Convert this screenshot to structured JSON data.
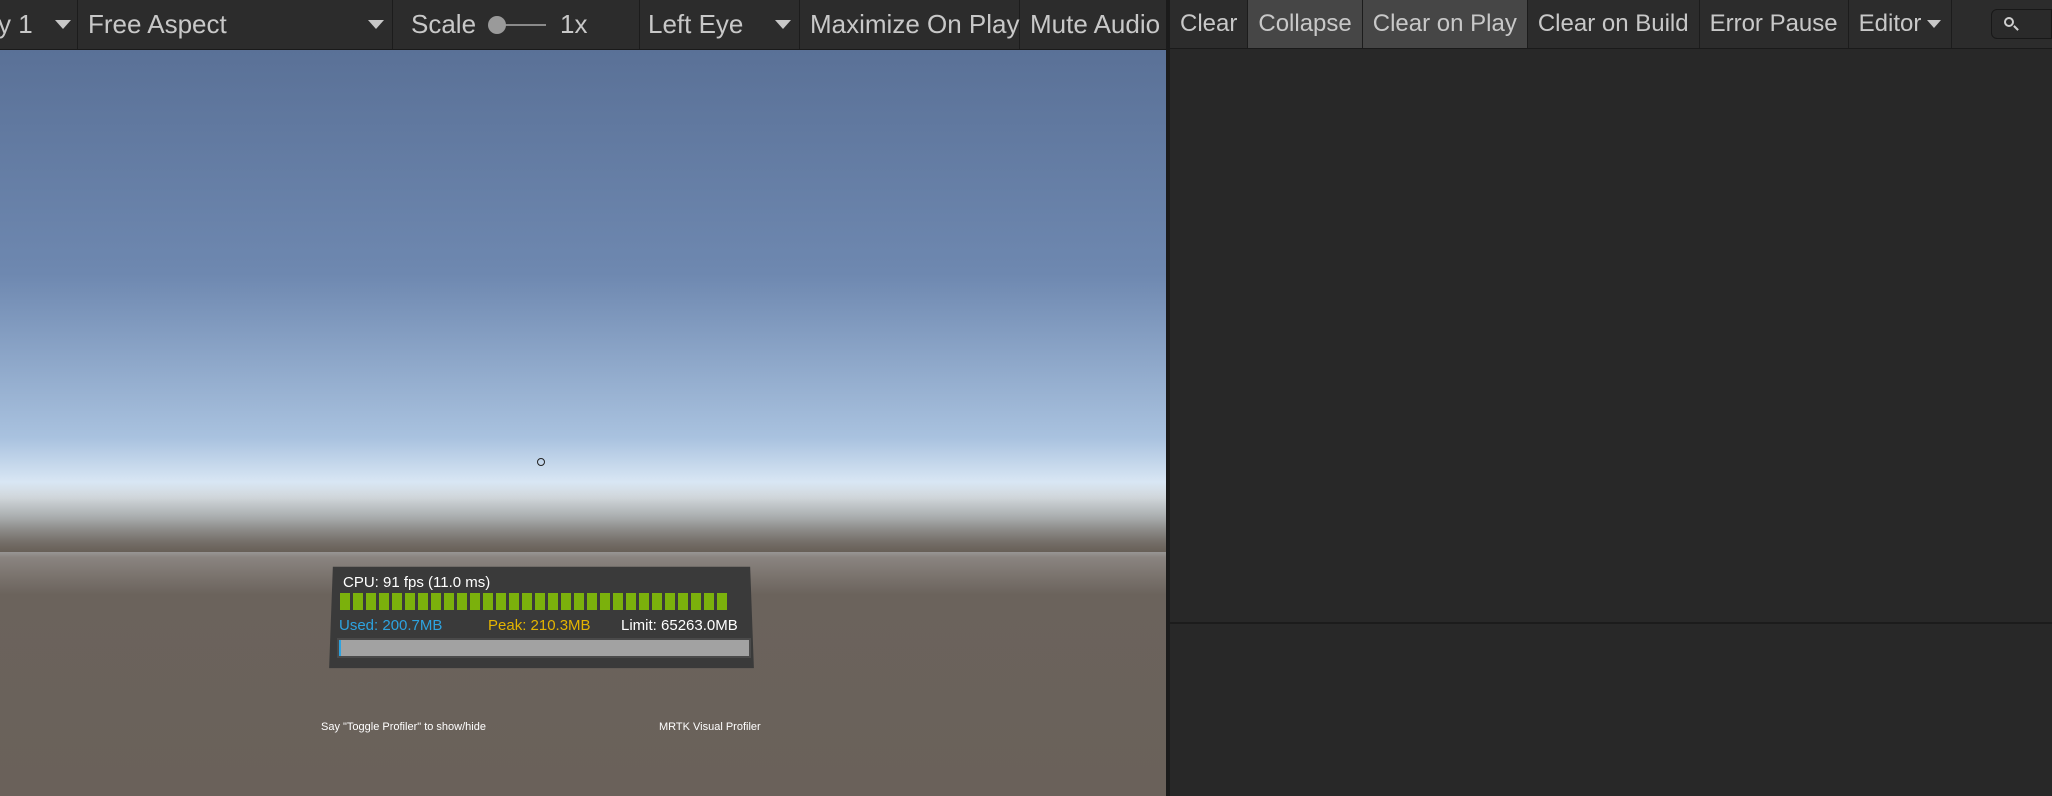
{
  "game_toolbar": {
    "display_label": "y 1",
    "aspect_label": "Free Aspect",
    "scale_label": "Scale",
    "scale_value": "1x",
    "eye_label": "Left Eye",
    "maximize_label": "Maximize On Play",
    "mute_label": "Mute Audio"
  },
  "profiler": {
    "cpu_text": "CPU: 91 fps (11.0 ms)",
    "used_text": "Used: 200.7MB",
    "peak_text": "Peak: 210.3MB",
    "limit_text": "Limit: 65263.0MB",
    "memory_used_fraction": 0.003,
    "hint_text": "Say \"Toggle Profiler\" to show/hide",
    "brand_text": "MRTK Visual Profiler",
    "colors": {
      "bar": "#7bb10c",
      "used": "#2da3e0",
      "peak": "#e4b400",
      "panel": "#3a3a3a"
    }
  },
  "console_toolbar": {
    "clear_label": "Clear",
    "collapse_label": "Collapse",
    "clear_on_play_label": "Clear on Play",
    "clear_on_build_label": "Clear on Build",
    "error_pause_label": "Error Pause",
    "editor_label": "Editor"
  },
  "icons": [
    "chevron-down-icon",
    "search-icon",
    "reticle-icon"
  ]
}
